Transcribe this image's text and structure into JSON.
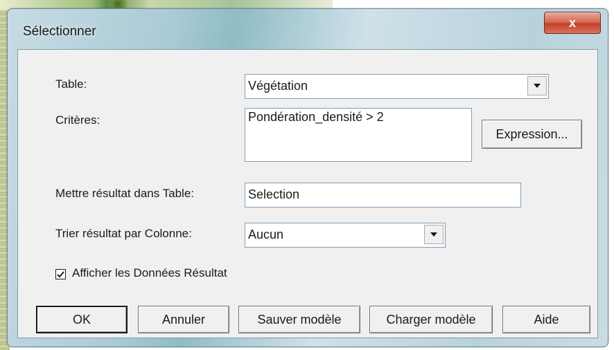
{
  "window": {
    "title": "Sélectionner",
    "close_glyph": "x"
  },
  "form": {
    "table": {
      "label": "Table:",
      "value": "Végétation"
    },
    "criteria": {
      "label": "Critères:",
      "value": "Pondération_densité > 2",
      "expression_button": "Expression..."
    },
    "result_table": {
      "label": "Mettre résultat dans Table:",
      "value": "Selection"
    },
    "sort_column": {
      "label": "Trier résultat par Colonne:",
      "value": "Aucun"
    },
    "show_results": {
      "label": "Afficher les Données Résultat",
      "checked": true
    }
  },
  "buttons": {
    "ok": "OK",
    "cancel": "Annuler",
    "save_template": "Sauver modèle",
    "load_template": "Charger modèle",
    "help": "Aide"
  },
  "colors": {
    "close_button": "#c2432c",
    "dialog_face": "#f0f0f0",
    "field_border": "#7f9db9"
  },
  "icons": {
    "dropdown": "dropdown-arrow-icon",
    "checkbox": "checkmark-icon",
    "close": "close-icon"
  }
}
